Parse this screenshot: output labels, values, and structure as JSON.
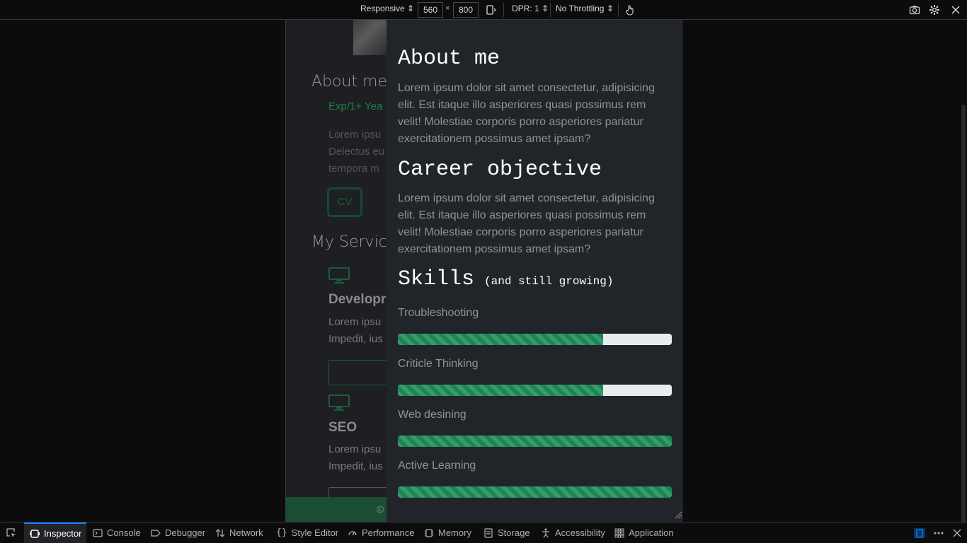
{
  "toolbar": {
    "device_select": "Responsive ⇕",
    "width": "560",
    "times": "×",
    "height": "800",
    "dpr": "DPR: 1 ⇕",
    "throttling": "No Throttling ⇕",
    "icons": [
      "rotate-icon",
      "touch-icon",
      "screenshot-icon",
      "settings-icon",
      "close-icon"
    ]
  },
  "page": {
    "about_heading": "About me",
    "exp_text": "Exp/1+ Yea",
    "para_lines": [
      "Lorem ipsu",
      "Delectus eu",
      "tempora m"
    ],
    "cv_label": "CV",
    "services_heading": "My Service",
    "service1_title": "Developr",
    "service1_lines": [
      "Lorem ipsu",
      "Impedit, ius"
    ],
    "service2_title": "SEO",
    "service2_lines": [
      "Lorem ipsu",
      "Impedit, ius"
    ],
    "footer_text": "©",
    "accent_color": "#198754"
  },
  "modal": {
    "about_heading": "About me",
    "about_text": "Lorem ipsum dolor sit amet consectetur, adipisicing elit. Est itaque illo asperiores quasi possimus rem velit! Molestiae corporis porro asperiores pariatur exercitationem possimus amet ipsam?",
    "career_heading": "Career objective",
    "career_text": "Lorem ipsum dolor sit amet consectetur, adipisicing elit. Est itaque illo asperiores quasi possimus rem velit! Molestiae corporis porro asperiores pariatur exercitationem possimus amet ipsam?",
    "skills_heading": "Skills",
    "skills_sub": "(and still growing)",
    "skills": [
      {
        "label": "Troubleshooting",
        "percent": 75
      },
      {
        "label": "Criticle Thinking",
        "percent": 75
      },
      {
        "label": "Web desining",
        "percent": 100
      },
      {
        "label": "Active Learning",
        "percent": 100
      }
    ]
  },
  "devtools": {
    "tabs": [
      "Inspector",
      "Console",
      "Debugger",
      "Network",
      "Style Editor",
      "Performance",
      "Memory",
      "Storage",
      "Accessibility",
      "Application"
    ],
    "active_tab": "Inspector"
  }
}
